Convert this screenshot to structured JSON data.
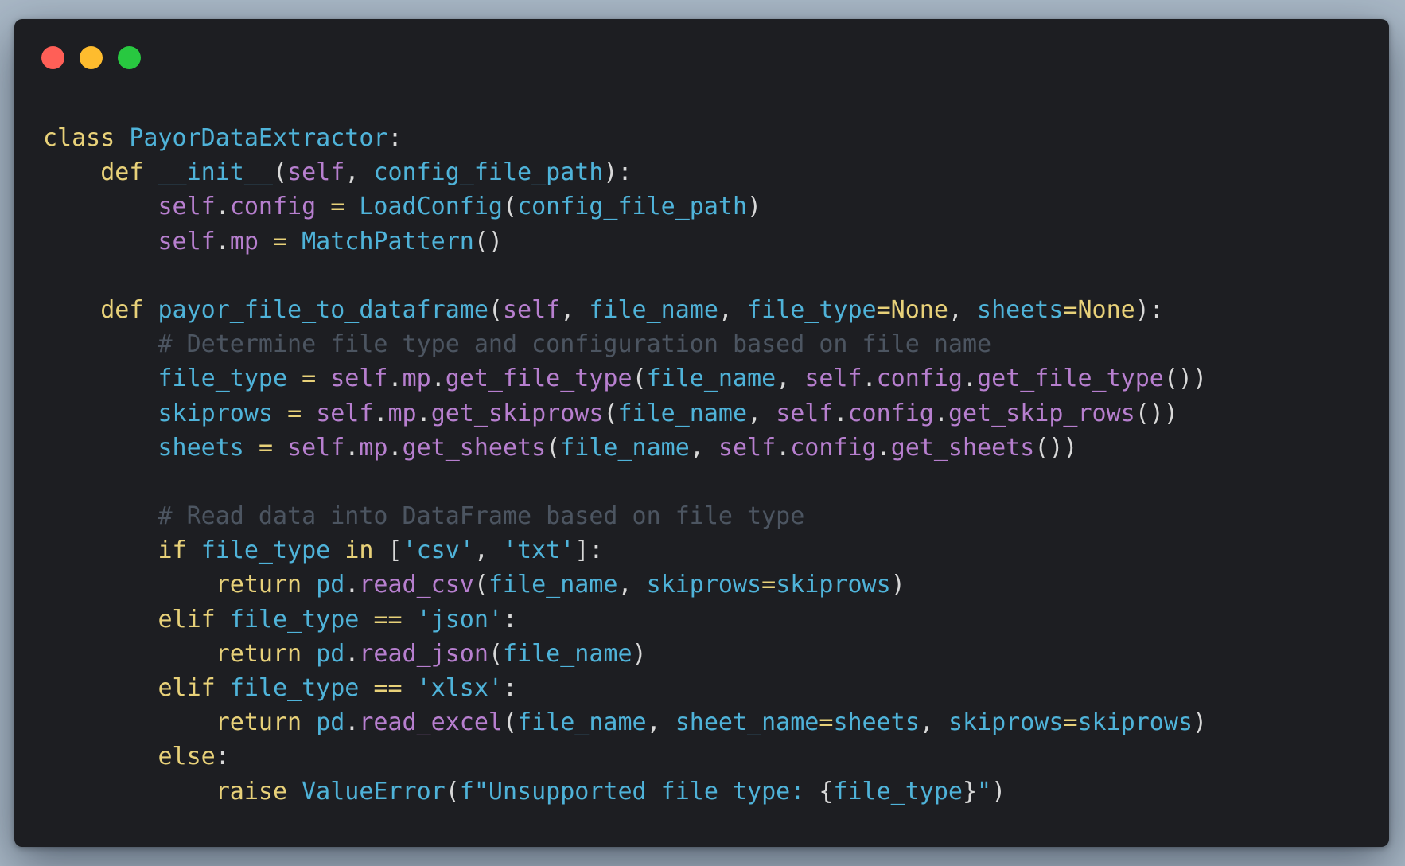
{
  "window": {
    "controls": [
      {
        "name": "close",
        "color": "#ff5f57"
      },
      {
        "name": "minimize",
        "color": "#febc2e"
      },
      {
        "name": "zoom",
        "color": "#28c840"
      }
    ]
  },
  "colors": {
    "background": "#a9b8c6",
    "editor_background": "#1d1e22",
    "keyword": "#e8d179",
    "identifier": "#4fb3d9",
    "self": "#b77fcf",
    "plain": "#d8d8d8",
    "comment": "#4c5561"
  },
  "code": {
    "language": "python",
    "lines": [
      [
        [
          "k",
          "class"
        ],
        [
          "p",
          " "
        ],
        [
          "f",
          "PayorDataExtractor"
        ],
        [
          "p",
          ":"
        ]
      ],
      [
        [
          "p",
          "    "
        ],
        [
          "k",
          "def"
        ],
        [
          "p",
          " "
        ],
        [
          "f",
          "__init__"
        ],
        [
          "p",
          "("
        ],
        [
          "s",
          "self"
        ],
        [
          "p",
          ", "
        ],
        [
          "f",
          "config_file_path"
        ],
        [
          "p",
          "):"
        ]
      ],
      [
        [
          "p",
          "        "
        ],
        [
          "s",
          "self"
        ],
        [
          "p",
          "."
        ],
        [
          "s",
          "config"
        ],
        [
          "p",
          " "
        ],
        [
          "k",
          "="
        ],
        [
          "p",
          " "
        ],
        [
          "f",
          "LoadConfig"
        ],
        [
          "p",
          "("
        ],
        [
          "f",
          "config_file_path"
        ],
        [
          "p",
          ")"
        ]
      ],
      [
        [
          "p",
          "        "
        ],
        [
          "s",
          "self"
        ],
        [
          "p",
          "."
        ],
        [
          "s",
          "mp"
        ],
        [
          "p",
          " "
        ],
        [
          "k",
          "="
        ],
        [
          "p",
          " "
        ],
        [
          "f",
          "MatchPattern"
        ],
        [
          "p",
          "()"
        ]
      ],
      [],
      [
        [
          "p",
          "    "
        ],
        [
          "k",
          "def"
        ],
        [
          "p",
          " "
        ],
        [
          "f",
          "payor_file_to_dataframe"
        ],
        [
          "p",
          "("
        ],
        [
          "s",
          "self"
        ],
        [
          "p",
          ", "
        ],
        [
          "f",
          "file_name"
        ],
        [
          "p",
          ", "
        ],
        [
          "f",
          "file_type"
        ],
        [
          "k",
          "=None"
        ],
        [
          "p",
          ", "
        ],
        [
          "f",
          "sheets"
        ],
        [
          "k",
          "=None"
        ],
        [
          "p",
          "):"
        ]
      ],
      [
        [
          "p",
          "        "
        ],
        [
          "c",
          "# Determine file type and configuration based on file name"
        ]
      ],
      [
        [
          "p",
          "        "
        ],
        [
          "f",
          "file_type"
        ],
        [
          "p",
          " "
        ],
        [
          "k",
          "="
        ],
        [
          "p",
          " "
        ],
        [
          "s",
          "self"
        ],
        [
          "p",
          "."
        ],
        [
          "s",
          "mp"
        ],
        [
          "p",
          "."
        ],
        [
          "s",
          "get_file_type"
        ],
        [
          "p",
          "("
        ],
        [
          "f",
          "file_name"
        ],
        [
          "p",
          ", "
        ],
        [
          "s",
          "self"
        ],
        [
          "p",
          "."
        ],
        [
          "s",
          "config"
        ],
        [
          "p",
          "."
        ],
        [
          "s",
          "get_file_type"
        ],
        [
          "p",
          "())"
        ]
      ],
      [
        [
          "p",
          "        "
        ],
        [
          "f",
          "skiprows"
        ],
        [
          "p",
          " "
        ],
        [
          "k",
          "="
        ],
        [
          "p",
          " "
        ],
        [
          "s",
          "self"
        ],
        [
          "p",
          "."
        ],
        [
          "s",
          "mp"
        ],
        [
          "p",
          "."
        ],
        [
          "s",
          "get_skiprows"
        ],
        [
          "p",
          "("
        ],
        [
          "f",
          "file_name"
        ],
        [
          "p",
          ", "
        ],
        [
          "s",
          "self"
        ],
        [
          "p",
          "."
        ],
        [
          "s",
          "config"
        ],
        [
          "p",
          "."
        ],
        [
          "s",
          "get_skip_rows"
        ],
        [
          "p",
          "())"
        ]
      ],
      [
        [
          "p",
          "        "
        ],
        [
          "f",
          "sheets"
        ],
        [
          "p",
          " "
        ],
        [
          "k",
          "="
        ],
        [
          "p",
          " "
        ],
        [
          "s",
          "self"
        ],
        [
          "p",
          "."
        ],
        [
          "s",
          "mp"
        ],
        [
          "p",
          "."
        ],
        [
          "s",
          "get_sheets"
        ],
        [
          "p",
          "("
        ],
        [
          "f",
          "file_name"
        ],
        [
          "p",
          ", "
        ],
        [
          "s",
          "self"
        ],
        [
          "p",
          "."
        ],
        [
          "s",
          "config"
        ],
        [
          "p",
          "."
        ],
        [
          "s",
          "get_sheets"
        ],
        [
          "p",
          "())"
        ]
      ],
      [],
      [
        [
          "p",
          "        "
        ],
        [
          "c",
          "# Read data into DataFrame based on file type"
        ]
      ],
      [
        [
          "p",
          "        "
        ],
        [
          "k",
          "if"
        ],
        [
          "p",
          " "
        ],
        [
          "f",
          "file_type"
        ],
        [
          "p",
          " "
        ],
        [
          "k",
          "in"
        ],
        [
          "p",
          " ["
        ],
        [
          "f",
          "'csv'"
        ],
        [
          "p",
          ", "
        ],
        [
          "f",
          "'txt'"
        ],
        [
          "p",
          "]:"
        ]
      ],
      [
        [
          "p",
          "            "
        ],
        [
          "k",
          "return"
        ],
        [
          "p",
          " "
        ],
        [
          "f",
          "pd"
        ],
        [
          "p",
          "."
        ],
        [
          "s",
          "read_csv"
        ],
        [
          "p",
          "("
        ],
        [
          "f",
          "file_name"
        ],
        [
          "p",
          ", "
        ],
        [
          "f",
          "skiprows"
        ],
        [
          "k",
          "="
        ],
        [
          "f",
          "skiprows"
        ],
        [
          "p",
          ")"
        ]
      ],
      [
        [
          "p",
          "        "
        ],
        [
          "k",
          "elif"
        ],
        [
          "p",
          " "
        ],
        [
          "f",
          "file_type"
        ],
        [
          "p",
          " "
        ],
        [
          "k",
          "=="
        ],
        [
          "p",
          " "
        ],
        [
          "f",
          "'json'"
        ],
        [
          "p",
          ":"
        ]
      ],
      [
        [
          "p",
          "            "
        ],
        [
          "k",
          "return"
        ],
        [
          "p",
          " "
        ],
        [
          "f",
          "pd"
        ],
        [
          "p",
          "."
        ],
        [
          "s",
          "read_json"
        ],
        [
          "p",
          "("
        ],
        [
          "f",
          "file_name"
        ],
        [
          "p",
          ")"
        ]
      ],
      [
        [
          "p",
          "        "
        ],
        [
          "k",
          "elif"
        ],
        [
          "p",
          " "
        ],
        [
          "f",
          "file_type"
        ],
        [
          "p",
          " "
        ],
        [
          "k",
          "=="
        ],
        [
          "p",
          " "
        ],
        [
          "f",
          "'xlsx'"
        ],
        [
          "p",
          ":"
        ]
      ],
      [
        [
          "p",
          "            "
        ],
        [
          "k",
          "return"
        ],
        [
          "p",
          " "
        ],
        [
          "f",
          "pd"
        ],
        [
          "p",
          "."
        ],
        [
          "s",
          "read_excel"
        ],
        [
          "p",
          "("
        ],
        [
          "f",
          "file_name"
        ],
        [
          "p",
          ", "
        ],
        [
          "f",
          "sheet_name"
        ],
        [
          "k",
          "="
        ],
        [
          "f",
          "sheets"
        ],
        [
          "p",
          ", "
        ],
        [
          "f",
          "skiprows"
        ],
        [
          "k",
          "="
        ],
        [
          "f",
          "skiprows"
        ],
        [
          "p",
          ")"
        ]
      ],
      [
        [
          "p",
          "        "
        ],
        [
          "k",
          "else"
        ],
        [
          "p",
          ":"
        ]
      ],
      [
        [
          "p",
          "            "
        ],
        [
          "k",
          "raise"
        ],
        [
          "p",
          " "
        ],
        [
          "f",
          "ValueError"
        ],
        [
          "p",
          "("
        ],
        [
          "f",
          "f\"Unsupported file type: "
        ],
        [
          "p",
          "{"
        ],
        [
          "f",
          "file_type"
        ],
        [
          "p",
          "}"
        ],
        [
          "f",
          "\""
        ],
        [
          "p",
          ")"
        ]
      ]
    ]
  }
}
